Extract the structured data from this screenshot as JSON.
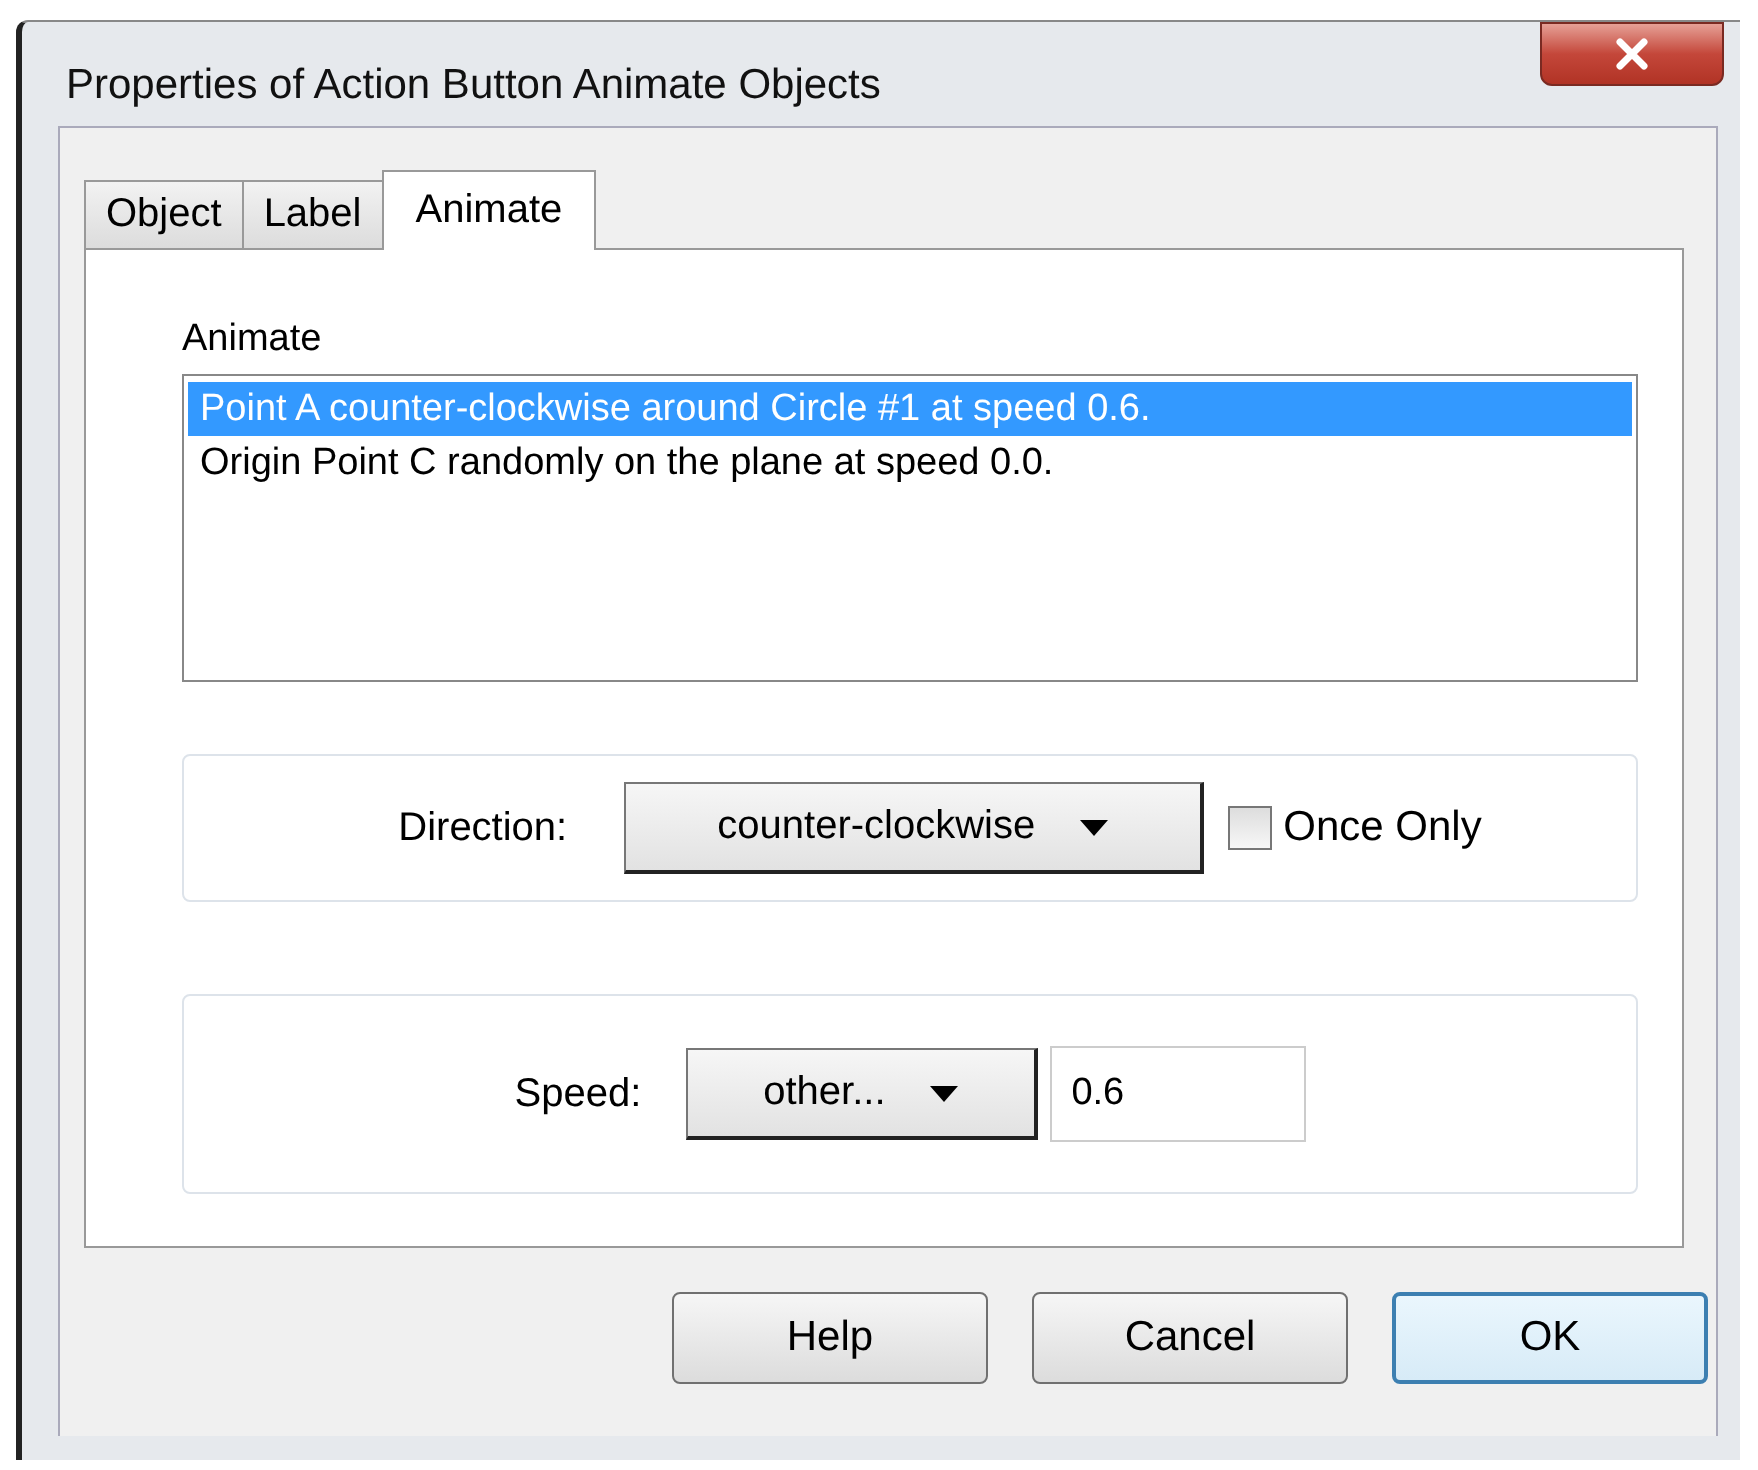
{
  "window": {
    "title": "Properties of Action Button Animate Objects"
  },
  "tabs": [
    {
      "label": "Object",
      "selected": false
    },
    {
      "label": "Label",
      "selected": false
    },
    {
      "label": "Animate",
      "selected": true
    }
  ],
  "animate": {
    "label": "Animate",
    "items": [
      {
        "text": "Point A counter-clockwise around Circle #1 at speed 0.6.",
        "selected": true
      },
      {
        "text": "Origin Point C randomly on the plane at speed 0.0.",
        "selected": false
      }
    ]
  },
  "direction": {
    "label": "Direction:",
    "value": "counter-clockwise",
    "once_only": {
      "label": "Once Only",
      "checked": false
    }
  },
  "speed": {
    "label": "Speed:",
    "value": "other...",
    "field": "0.6"
  },
  "buttons": [
    {
      "label": "Help",
      "default": false
    },
    {
      "label": "Cancel",
      "default": false
    },
    {
      "label": "OK",
      "default": true
    }
  ]
}
